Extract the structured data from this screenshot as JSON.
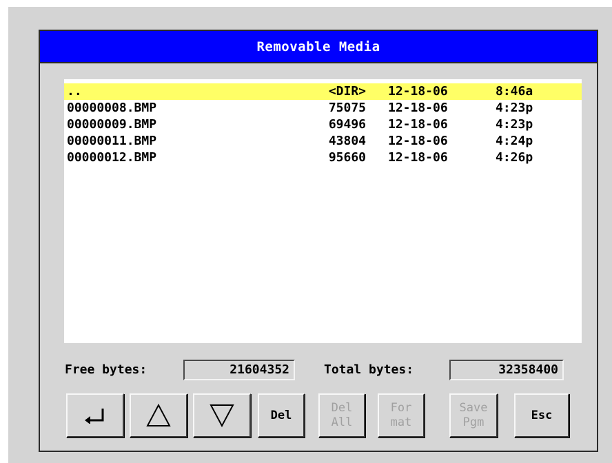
{
  "window": {
    "title": "Removable Media"
  },
  "files": [
    {
      "name": "..",
      "size": "<DIR>",
      "date": "12-18-06",
      "time": "8:46a",
      "selected": true
    },
    {
      "name": "00000008.BMP",
      "size": "75075",
      "date": "12-18-06",
      "time": "4:23p",
      "selected": false
    },
    {
      "name": "00000009.BMP",
      "size": "69496",
      "date": "12-18-06",
      "time": "4:23p",
      "selected": false
    },
    {
      "name": "00000011.BMP",
      "size": "43804",
      "date": "12-18-06",
      "time": "4:24p",
      "selected": false
    },
    {
      "name": "00000012.BMP",
      "size": "95660",
      "date": "12-18-06",
      "time": "4:26p",
      "selected": false
    }
  ],
  "status": {
    "free_label": "Free bytes:",
    "free_value": "21604352",
    "total_label": "Total bytes:",
    "total_value": "32358400"
  },
  "buttons": {
    "enter_icon": "enter-arrow-icon",
    "up_icon": "triangle-up-icon",
    "down_icon": "triangle-down-icon",
    "del": "Del",
    "del_all_1": "Del",
    "del_all_2": "All",
    "format_1": "For",
    "format_2": "mat",
    "save_pgm_1": "Save",
    "save_pgm_2": "Pgm",
    "esc": "Esc"
  },
  "colors": {
    "titlebar": "#0000fe",
    "selection": "#ffff66",
    "panel": "#d6d6d6"
  }
}
